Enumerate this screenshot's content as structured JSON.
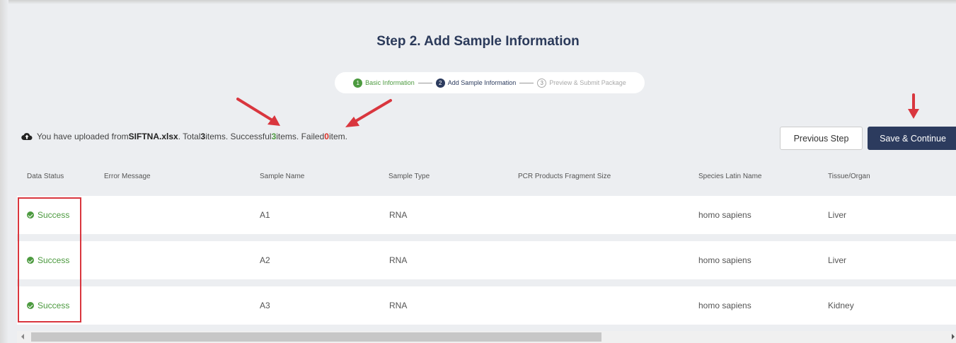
{
  "page": {
    "title": "Step 2. Add Sample Information"
  },
  "stepper": {
    "steps": [
      {
        "num": "1",
        "label": "Basic Information",
        "state": "done"
      },
      {
        "num": "2",
        "label": "Add Sample Information",
        "state": "active"
      },
      {
        "num": "3",
        "label": "Preview & Submit Package",
        "state": "pending"
      }
    ]
  },
  "upload": {
    "icon": "cloud-upload-icon",
    "prefix": "You have uploaded from ",
    "file": "SIFTNA.xlsx",
    "total_text": ". Total ",
    "total": "3",
    "success_text": " items. Successful ",
    "success": "3",
    "failed_text": " items. Failed ",
    "failed": "0",
    "suffix": " item."
  },
  "buttons": {
    "previous": "Previous Step",
    "save": "Save & Continue"
  },
  "table": {
    "headers": [
      "Data Status",
      "Error Message",
      "Sample Name",
      "Sample Type",
      "PCR Products Fragment Size",
      "Species Latin Name",
      "Tissue/Organ"
    ],
    "rows": [
      {
        "status": "Success",
        "error": "",
        "sample_name": "A1",
        "sample_type": "RNA",
        "fragment_size": "",
        "species": "homo sapiens",
        "tissue": "Liver"
      },
      {
        "status": "Success",
        "error": "",
        "sample_name": "A2",
        "sample_type": "RNA",
        "fragment_size": "",
        "species": "homo sapiens",
        "tissue": "Liver"
      },
      {
        "status": "Success",
        "error": "",
        "sample_name": "A3",
        "sample_type": "RNA",
        "fragment_size": "",
        "species": "homo sapiens",
        "tissue": "Kidney"
      }
    ]
  },
  "colors": {
    "primary": "#2c3b5e",
    "success": "#4c9a3f",
    "danger": "#d93025",
    "annotation": "#d9363e"
  }
}
